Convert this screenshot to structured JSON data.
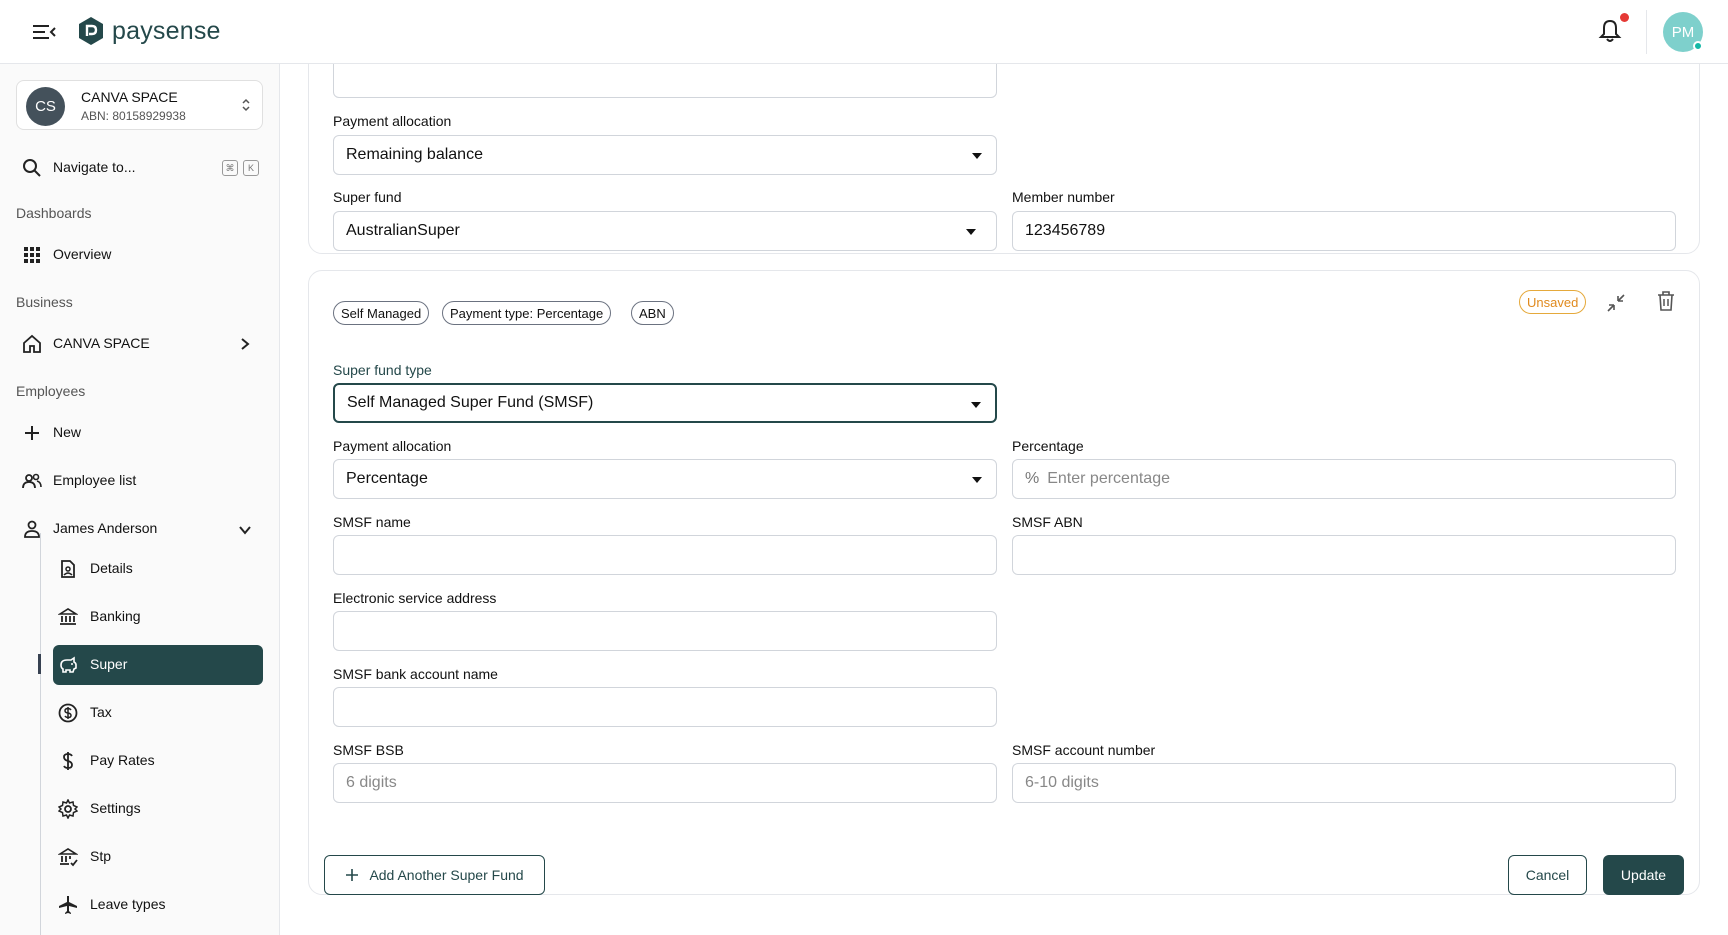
{
  "header": {
    "brand": "paysense",
    "avatar_initials": "PM"
  },
  "sidebar": {
    "org": {
      "initials": "CS",
      "name": "CANVA SPACE",
      "abn": "ABN: 80158929938"
    },
    "search": {
      "label": "Navigate to...",
      "kbd_1": "⌘",
      "kbd_2": "K"
    },
    "sections": {
      "dashboards": "Dashboards",
      "business": "Business",
      "employees": "Employees"
    },
    "items": {
      "overview": "Overview",
      "business_org": "CANVA SPACE",
      "new": "New",
      "employee_list": "Employee list",
      "employee_name": "James Anderson"
    },
    "employee_sub": [
      {
        "label": "Details",
        "icon": "document-icon"
      },
      {
        "label": "Banking",
        "icon": "bank-icon"
      },
      {
        "label": "Super",
        "icon": "piggy-bank-icon"
      },
      {
        "label": "Tax",
        "icon": "dollar-circle-icon"
      },
      {
        "label": "Pay Rates",
        "icon": "dollar-icon"
      },
      {
        "label": "Settings",
        "icon": "gear-icon"
      },
      {
        "label": "Stp",
        "icon": "bank-check-icon"
      },
      {
        "label": "Leave types",
        "icon": "plane-icon"
      }
    ],
    "active_item": "Super"
  },
  "fund1": {
    "payment_allocation_label": "Payment allocation",
    "payment_allocation_value": "Remaining balance",
    "super_fund_label": "Super fund",
    "super_fund_value": "AustralianSuper",
    "member_number_label": "Member number",
    "member_number_value": "123456789"
  },
  "fund2": {
    "chips": [
      "Self Managed",
      "Payment type: Percentage",
      "ABN"
    ],
    "status_badge": "Unsaved",
    "super_fund_type_label": "Super fund type",
    "super_fund_type_value": "Self Managed Super Fund (SMSF)",
    "payment_allocation_label": "Payment allocation",
    "payment_allocation_value": "Percentage",
    "percentage_label": "Percentage",
    "percentage_prefix": "%",
    "percentage_placeholder": "Enter percentage",
    "smsf_name_label": "SMSF name",
    "smsf_name_value": "",
    "smsf_abn_label": "SMSF ABN",
    "smsf_abn_value": "",
    "esa_label": "Electronic service address",
    "esa_value": "",
    "bank_account_name_label": "SMSF bank account name",
    "bank_account_name_value": "",
    "bsb_label": "SMSF BSB",
    "bsb_placeholder": "6 digits",
    "account_number_label": "SMSF account number",
    "account_number_placeholder": "6-10 digits"
  },
  "actions": {
    "add_another": "Add Another Super Fund",
    "cancel": "Cancel",
    "update": "Update"
  },
  "colors": {
    "brand": "#24484a",
    "unsaved": "#e08a1e",
    "notification": "#e53935"
  }
}
